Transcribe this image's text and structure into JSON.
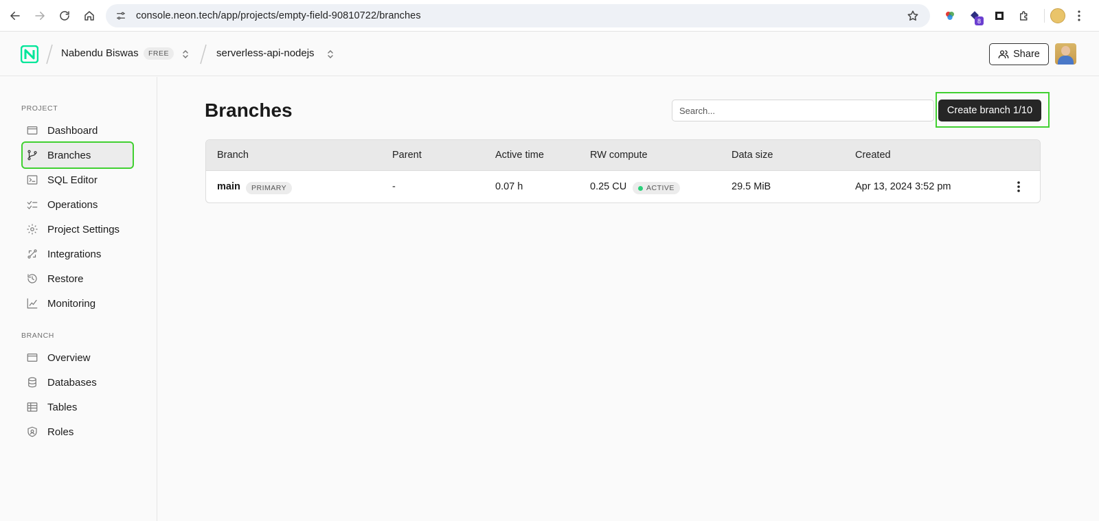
{
  "browser": {
    "url": "console.neon.tech/app/projects/empty-field-90810722/branches",
    "extension_badge": "8"
  },
  "header": {
    "org_name": "Nabendu Biswas",
    "plan": "FREE",
    "project_name": "serverless-api-nodejs",
    "share_label": "Share"
  },
  "sidebar": {
    "project_section": "PROJECT",
    "project_items": [
      {
        "label": "Dashboard",
        "icon": "dashboard-icon"
      },
      {
        "label": "Branches",
        "icon": "branch-icon",
        "active": true
      },
      {
        "label": "SQL Editor",
        "icon": "sql-editor-icon"
      },
      {
        "label": "Operations",
        "icon": "operations-icon"
      },
      {
        "label": "Project Settings",
        "icon": "gear-icon"
      },
      {
        "label": "Integrations",
        "icon": "integrations-icon"
      },
      {
        "label": "Restore",
        "icon": "restore-icon"
      },
      {
        "label": "Monitoring",
        "icon": "monitoring-icon"
      }
    ],
    "branch_section": "BRANCH",
    "branch_items": [
      {
        "label": "Overview",
        "icon": "overview-icon"
      },
      {
        "label": "Databases",
        "icon": "database-icon"
      },
      {
        "label": "Tables",
        "icon": "table-icon"
      },
      {
        "label": "Roles",
        "icon": "roles-icon"
      }
    ]
  },
  "main": {
    "title": "Branches",
    "search_placeholder": "Search...",
    "create_button": "Create branch 1/10",
    "table": {
      "columns": [
        "Branch",
        "Parent",
        "Active time",
        "RW compute",
        "Data size",
        "Created"
      ],
      "rows": [
        {
          "branch": "main",
          "branch_badge": "PRIMARY",
          "parent": "-",
          "active_time": "0.07 h",
          "rw_compute": "0.25 CU",
          "compute_status": "ACTIVE",
          "data_size": "29.5 MiB",
          "created": "Apr 13, 2024 3:52 pm"
        }
      ]
    }
  },
  "colors": {
    "highlight": "#40d030",
    "primary_button": "#262626",
    "active_dot": "#2bd07a",
    "logo": "#00e699"
  }
}
